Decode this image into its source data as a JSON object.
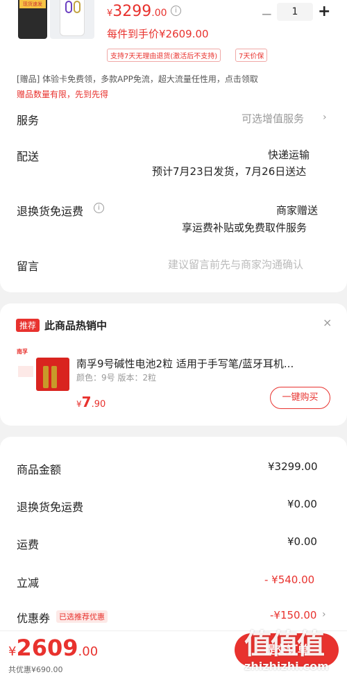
{
  "product": {
    "thumb_tag": "现货速发",
    "price_symbol": "¥",
    "price": "3299",
    "price_decimal": ".00",
    "net_price_text": "每件到手价¥2609.00",
    "quantity": "1",
    "return_tag": "支持7天无理由退货(激活后不支持)",
    "protect_tag": "7天价保"
  },
  "gift": {
    "text": "[赠品]  体验卡免费领，多款APP免流，超大流量任性用，点击领取",
    "limited": "赠品数量有限，先到先得"
  },
  "service": {
    "label": "服务",
    "value": "可选增值服务"
  },
  "delivery": {
    "label": "配送",
    "method": "快递运输",
    "eta": "预计7月23日发货，7月26日送达"
  },
  "return_shipping": {
    "label": "退换货免运费",
    "line1": "商家赠送",
    "line2": "享运费补贴或免费取件服务"
  },
  "message": {
    "label": "留言",
    "placeholder": "建议留言前先与商家沟通确认"
  },
  "recommend": {
    "badge": "推荐",
    "title": "此商品热销中",
    "item_brand": "南孚",
    "item_name": "南孚9号碱性电池2粒 适用于手写笔/蓝牙耳机...",
    "item_spec": "颜色：9号  版本：2粒",
    "price_symbol": "¥",
    "price_int": "7",
    "price_dec": ".90",
    "buy_label": "一键购买"
  },
  "summary": {
    "rows": [
      {
        "label": "商品金额",
        "value": "¥3299.00"
      },
      {
        "label": "退换货免运费",
        "value": "¥0.00"
      },
      {
        "label": "运费",
        "value": "¥0.00"
      },
      {
        "label": "立减",
        "value": "- ¥540.00"
      },
      {
        "label": "优惠券",
        "tag": "已选推荐优惠",
        "value": "-¥150.00"
      }
    ]
  },
  "footer": {
    "total_symbol": "¥",
    "total_int": "2609",
    "total_dec": ".00",
    "saved": "共优惠¥690.00",
    "submit": "提交订单",
    "watermark": "值值值",
    "watermark_url": "zhizhizhi.com"
  },
  "colors": {
    "accent": "#e8322e",
    "background": "#f2f2f2"
  }
}
